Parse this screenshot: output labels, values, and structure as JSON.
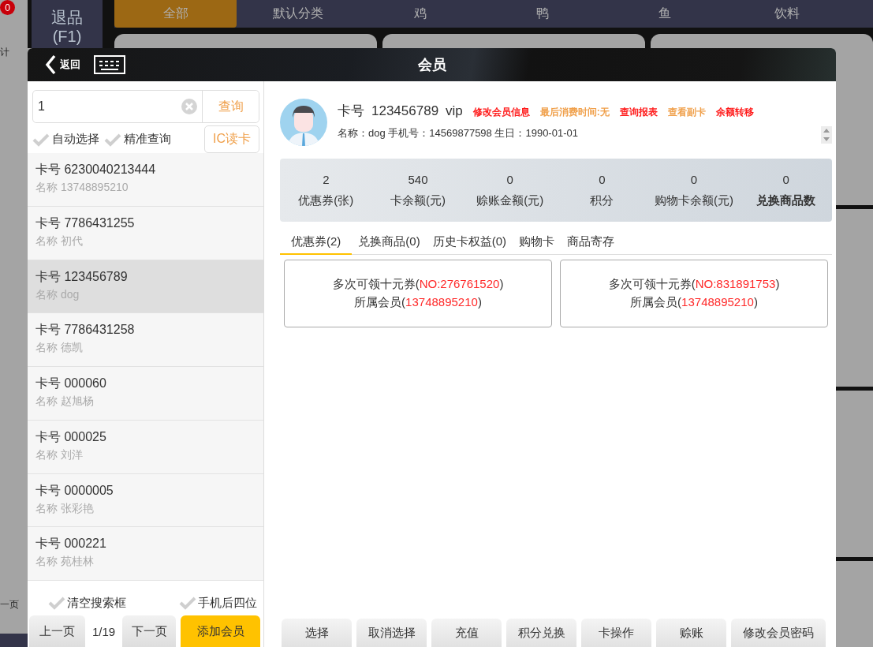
{
  "back": {
    "side_badge": "0",
    "side_label": "计",
    "side_pager": "一页",
    "return_button": {
      "label": "退品",
      "key": "(F1)"
    },
    "categories": [
      {
        "label": "全部",
        "selected": true
      },
      {
        "label": "默认分类",
        "selected": false
      },
      {
        "label": "鸡",
        "selected": false
      },
      {
        "label": "鸭",
        "selected": false
      },
      {
        "label": "鱼",
        "selected": false
      },
      {
        "label": "饮料",
        "selected": false
      }
    ]
  },
  "dialog": {
    "back_label": "返回",
    "title": "会员"
  },
  "search": {
    "value": "1",
    "button": "查询"
  },
  "options": [
    {
      "label": "自动选择",
      "checked": false
    },
    {
      "label": "精准查询",
      "checked": false
    }
  ],
  "ic_button": "IC读卡",
  "members": [
    {
      "card": "卡号 6230040213444",
      "name": "名称 13748895210",
      "selected": false
    },
    {
      "card": "卡号 7786431255",
      "name": "名称 初代",
      "selected": false
    },
    {
      "card": "卡号 123456789",
      "name": "名称 dog",
      "selected": true
    },
    {
      "card": "卡号 7786431258",
      "name": "名称 德凯",
      "selected": false
    },
    {
      "card": "卡号 000060",
      "name": "名称 赵旭杨",
      "selected": false
    },
    {
      "card": "卡号 000025",
      "name": "名称 刘洋",
      "selected": false
    },
    {
      "card": "卡号 0000005",
      "name": "名称 张彩艳",
      "selected": false
    },
    {
      "card": "卡号 000221",
      "name": "名称 苑桂林",
      "selected": false
    }
  ],
  "list_options": [
    {
      "label": "清空搜索框",
      "checked": false
    },
    {
      "label": "手机后四位",
      "checked": false
    }
  ],
  "pager": {
    "prev": "上一页",
    "page": "1/19",
    "next": "下一页",
    "add": "添加会员"
  },
  "profile": {
    "card_label": "卡号",
    "card_no": "123456789",
    "level": "vip",
    "details": "名称：dog 手机号：14569877598 生日：1990-01-01",
    "actions": [
      {
        "label": "修改会员信息",
        "color": "#ff1a1a"
      },
      {
        "label": "最后消费时间:无",
        "color": "#f0a04b"
      },
      {
        "label": "查询报表",
        "color": "#ff1a1a"
      },
      {
        "label": "查看副卡",
        "color": "#f0a04b"
      },
      {
        "label": "余额转移",
        "color": "#ff1a1a"
      }
    ]
  },
  "stats": [
    {
      "value": "2",
      "label": "优惠券(张)",
      "kind": "normal"
    },
    {
      "value": "540",
      "label": "卡余额(元)",
      "kind": "normal"
    },
    {
      "value": "0",
      "label": "赊账金额(元)",
      "kind": "normal"
    },
    {
      "value": "0",
      "label": "积分",
      "kind": "normal"
    },
    {
      "value": "0",
      "label": "购物卡余额(元)",
      "kind": "normal"
    },
    {
      "value": "0",
      "label": "兑换商品数",
      "kind": "bold"
    }
  ],
  "tabs": [
    {
      "label": "优惠券(2)",
      "selected": true
    },
    {
      "label": "兑换商品(0)",
      "selected": false
    },
    {
      "label": "历史卡权益(0)",
      "selected": false
    },
    {
      "label": "购物卡",
      "selected": false
    },
    {
      "label": "商品寄存",
      "selected": false
    }
  ],
  "coupons": [
    {
      "title": "多次可领十元券(",
      "code": "NO:276761520",
      "title_end": ")",
      "owner": "所属会员(",
      "owner_phone": "13748895210",
      "owner_end": ")"
    },
    {
      "title": "多次可领十元券(",
      "code": "NO:831891753",
      "title_end": ")",
      "owner": "所属会员(",
      "owner_phone": "13748895210",
      "owner_end": ")"
    }
  ],
  "actions": [
    "选择",
    "取消选择",
    "充值",
    "积分兑换",
    "卡操作",
    "赊账",
    "修改会员密码"
  ]
}
